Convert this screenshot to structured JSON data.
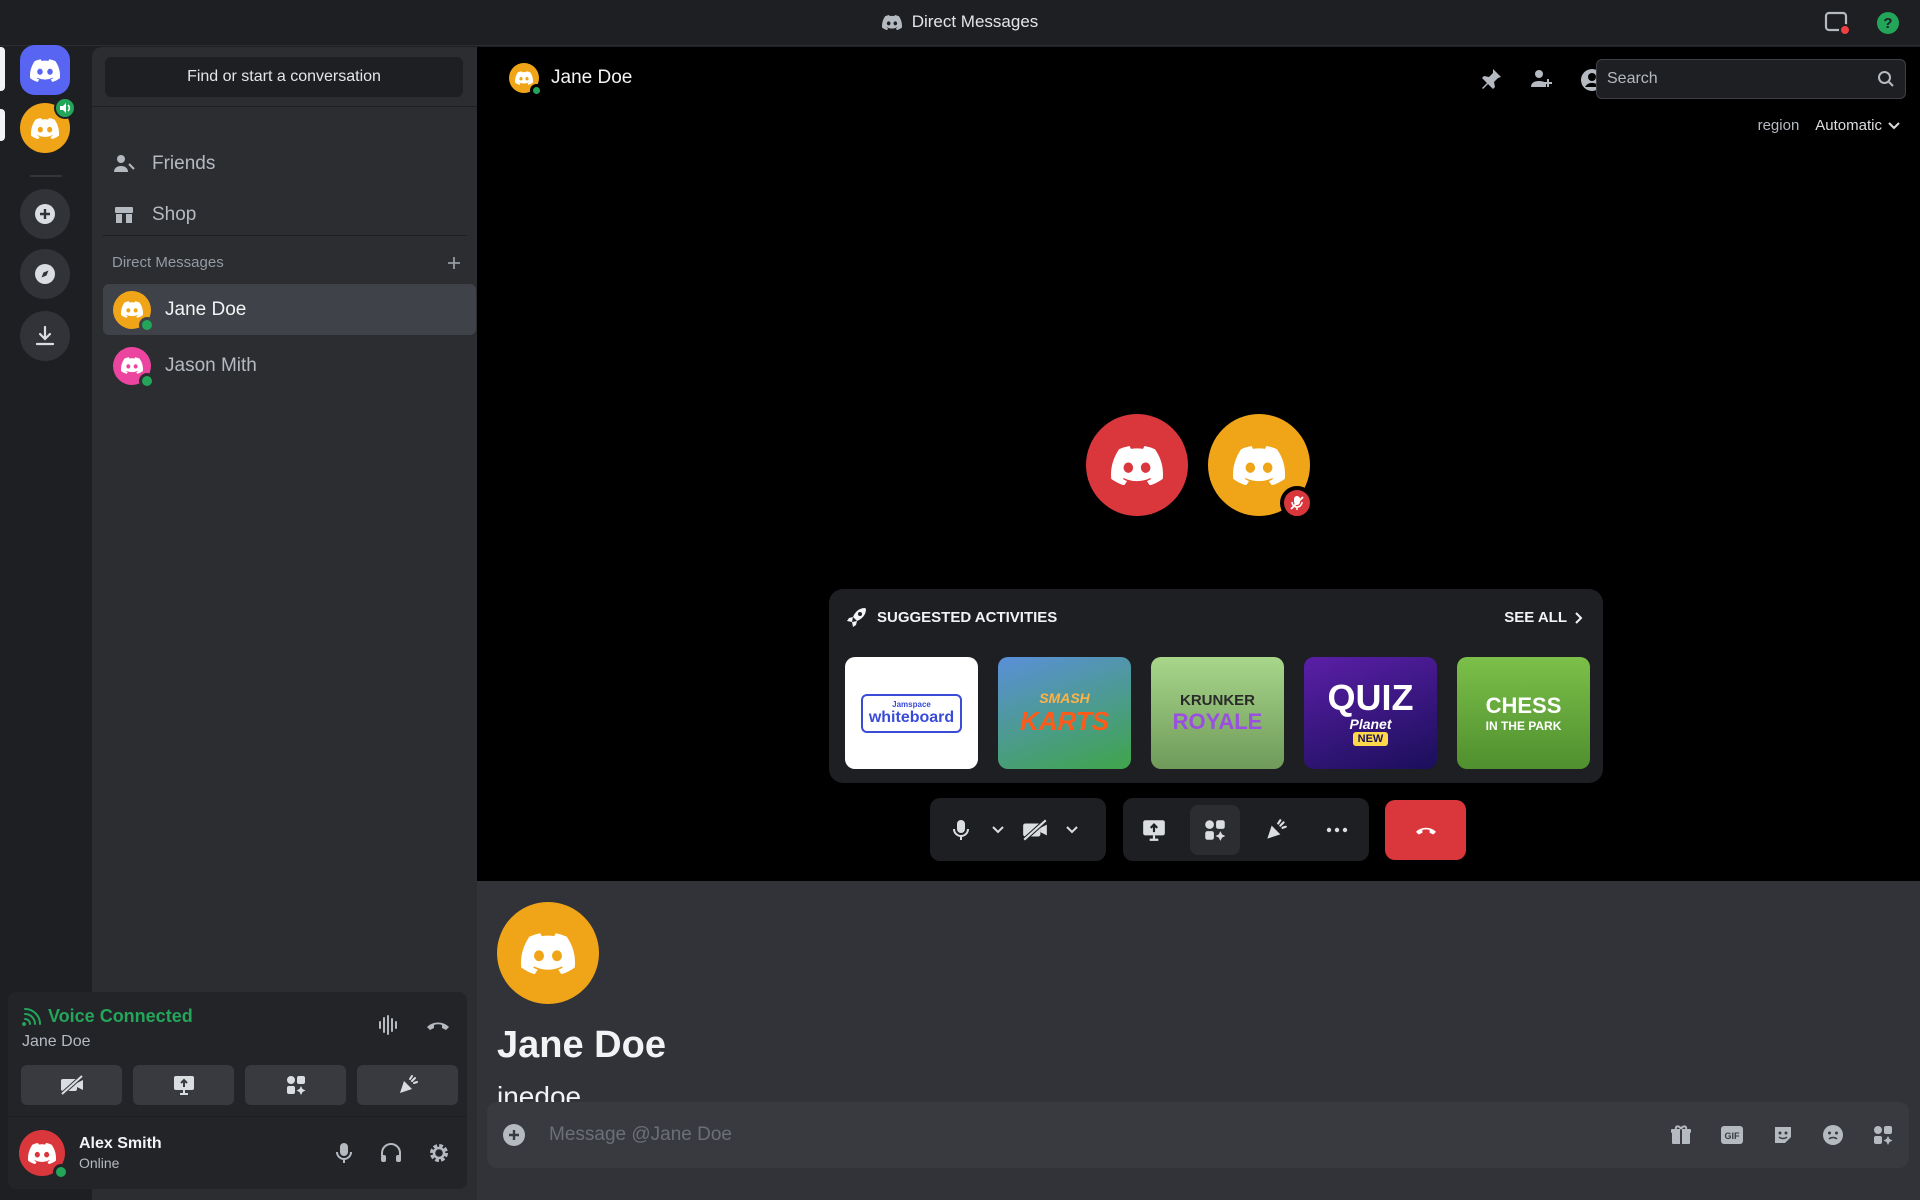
{
  "window": {
    "title": "Direct Messages"
  },
  "sidebar": {
    "search_label": "Find or start a conversation",
    "nav": [
      {
        "label": "Friends",
        "icon": "friends-icon"
      },
      {
        "label": "Shop",
        "icon": "shop-icon"
      }
    ],
    "dm_header": "Direct Messages",
    "dms": [
      {
        "name": "Jane Doe",
        "status": "online",
        "avatar_color": "#f0a518",
        "active": true
      },
      {
        "name": "Jason Mith",
        "status": "online",
        "avatar_color": "#eb459f",
        "active": false
      }
    ]
  },
  "voice": {
    "status": "Voice Connected",
    "channel": "Jane Doe"
  },
  "user": {
    "name": "Alex Smith",
    "status": "Online",
    "avatar_color": "#da373c"
  },
  "call": {
    "header_name": "Jane Doe",
    "search_placeholder": "Search",
    "region_label": "region",
    "region_value": "Automatic",
    "participants": [
      {
        "color": "#da373c",
        "muted": false
      },
      {
        "color": "#f0a518",
        "muted": true
      }
    ],
    "activities": {
      "title": "SUGGESTED ACTIVITIES",
      "see_all": "SEE ALL",
      "tiles": [
        {
          "line1": "Jamspace",
          "line2": "whiteboard",
          "bg": "#ffffff",
          "fg": "#3a4bd8"
        },
        {
          "line1": "SMASH",
          "line2": "KARTS",
          "bg": "#4a7cc9",
          "fg": "#ff7a1a"
        },
        {
          "line1": "KRUNKER",
          "line2": "ROYALE",
          "bg": "#7fb26a",
          "fg": "#e0c14a"
        },
        {
          "line1": "QUIZ",
          "line2": "Planet",
          "badge": "NEW",
          "bg": "#4b1a8c",
          "fg": "#ffffff"
        },
        {
          "line1": "CHESS",
          "line2": "IN THE PARK",
          "bg": "#6aa33d",
          "fg": "#ffffff"
        }
      ]
    }
  },
  "profile": {
    "name": "Jane Doe",
    "username": "jnedoe"
  },
  "composer": {
    "placeholder": "Message @Jane Doe"
  },
  "colors": {
    "accent": "#5865f2",
    "online": "#23a55a",
    "danger": "#da373c"
  }
}
